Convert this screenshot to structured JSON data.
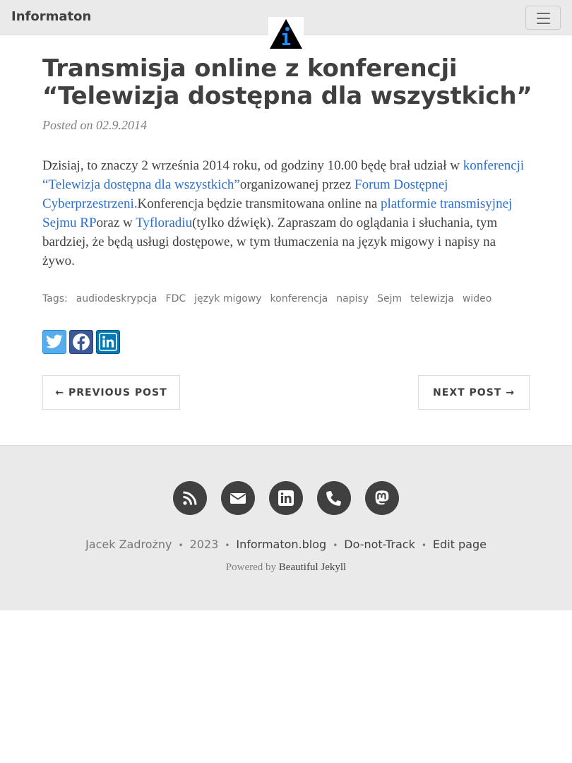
{
  "navbar": {
    "brand": "Informaton",
    "logo_icon": "info-triangle-logo",
    "menu_icon": "hamburger-menu-icon"
  },
  "post": {
    "title_line1": "Transmisja online z konferencji",
    "title_line2": "“Telewizja dostępna dla wszystkich”",
    "posted_on_label": "Posted on",
    "date": "02.9.2014",
    "body": {
      "t1": "Dzisiaj, to znaczy 2 września 2014 roku, od godziny 10.00 będę brał udział w ",
      "link1": "konferencji “Telewizja dostępna dla wszystkich”",
      "t2": "organizowanej przez ",
      "link2": "Forum Dostępnej Cyberprzestrzeni.",
      "t3": "Konferencja będzie transmitowana online na ",
      "link3": "platformie transmisyjnej Sejmu RP",
      "t4": "oraz w ",
      "link4": "Tyfloradiu",
      "t5": "(tylko dźwięk). Zapraszam do oglądania i słuchania, tym bardziej, że będą usługi dostępowe, w tym tłumaczenia na język migowy i napisy na żywo."
    },
    "tags_label": "Tags:",
    "tags": [
      "audiodeskrypcja",
      "FDC",
      "język migowy",
      "konferencja",
      "napisy",
      "Sejm",
      "telewizja",
      "wideo"
    ]
  },
  "share": [
    {
      "name": "twitter-icon"
    },
    {
      "name": "facebook-icon"
    },
    {
      "name": "linkedin-icon"
    }
  ],
  "pager": {
    "previous": "← PREVIOUS POST",
    "next": "NEXT POST →"
  },
  "footer": {
    "social_icons": [
      "rss-icon",
      "envelope-icon",
      "linkedin-icon",
      "phone-icon",
      "mastodon-icon"
    ],
    "author": "Jacek Zadrożny",
    "year": "2023",
    "site": "Informaton.blog",
    "dnt": "Do-not-Track",
    "edit": "Edit page",
    "separator": "•",
    "powered_by": "Powered by",
    "powered_link": "Beautiful Jekyll"
  },
  "colors": {
    "navbar_bg": "#eaeaea",
    "link": "#2a6fcf",
    "text": "#404040",
    "muted": "#777777",
    "footer_bg": "#eaeaea",
    "twitter": "#55acee",
    "facebook": "#3b5998",
    "linkedin": "#007bb6"
  }
}
